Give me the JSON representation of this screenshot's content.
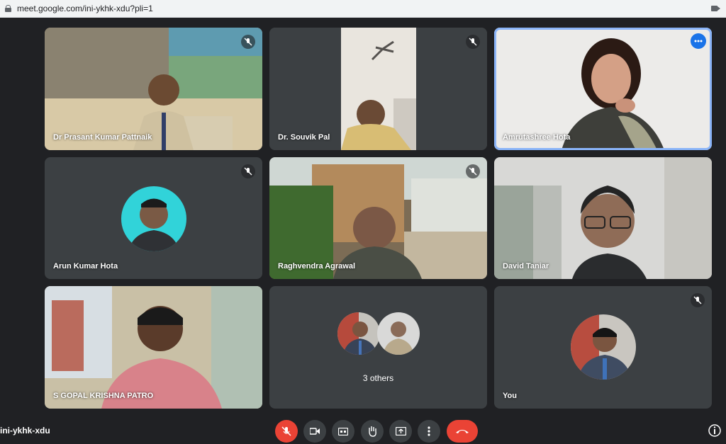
{
  "browser": {
    "url": "meet.google.com/ini-ykhk-xdu?pli=1"
  },
  "participants": [
    {
      "name": "Dr Prasant Kumar Pattnaik"
    },
    {
      "name": "Dr. Souvik Pal"
    },
    {
      "name": "Amrutashree Hota"
    },
    {
      "name": "Arun Kumar Hota"
    },
    {
      "name": "Raghvendra Agrawal"
    },
    {
      "name": "David Taniar"
    },
    {
      "name": "S GOPAL KRISHNA PATRO"
    },
    {
      "name": "3 others"
    },
    {
      "name": "You"
    }
  ],
  "meeting": {
    "code": "ini-ykhk-xdu"
  },
  "colors": {
    "background": "#202124",
    "tile": "#3c4043",
    "accent": "#1a73e8",
    "highlight": "#8ab4f8",
    "danger": "#ea4335"
  }
}
